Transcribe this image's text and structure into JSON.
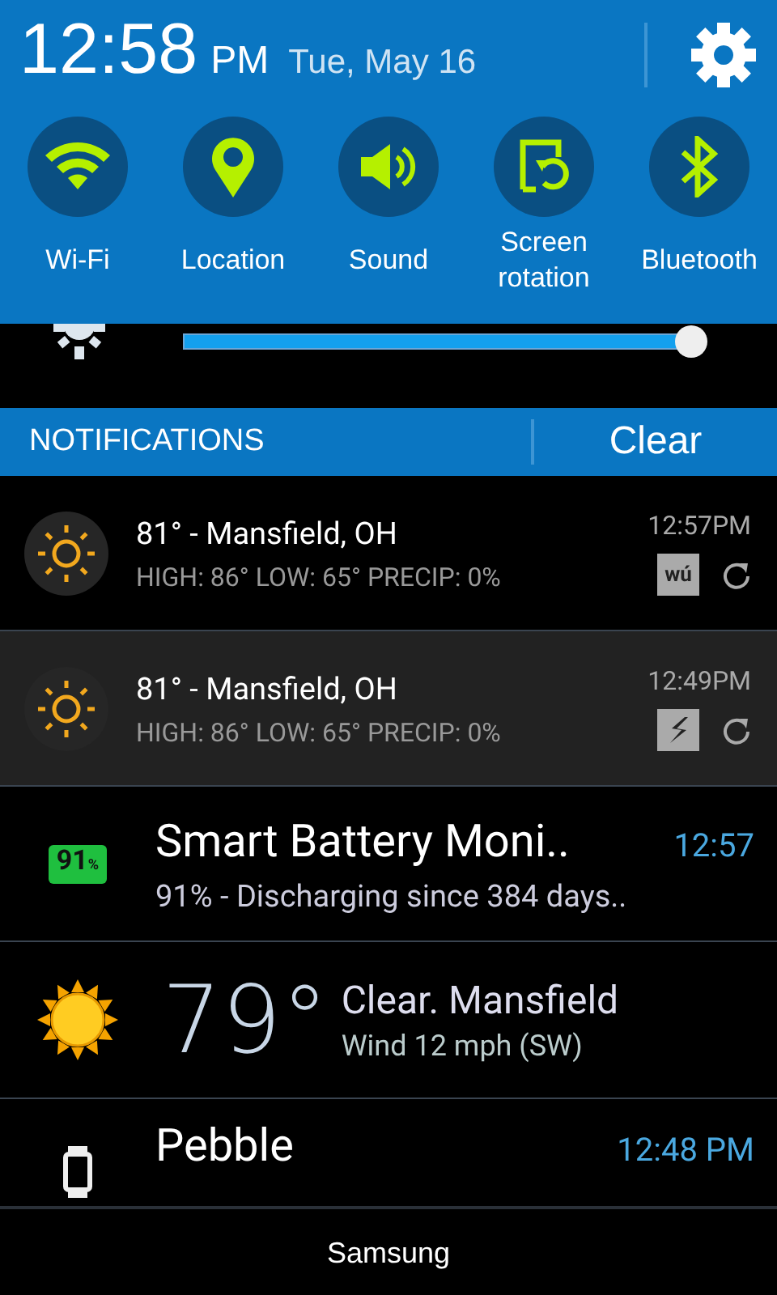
{
  "header": {
    "time": "12:58",
    "ampm": "PM",
    "date": "Tue, May 16"
  },
  "toggles": [
    {
      "kind": "wifi",
      "label": "Wi-Fi",
      "on": true
    },
    {
      "kind": "location",
      "label": "Location",
      "on": true
    },
    {
      "kind": "sound",
      "label": "Sound",
      "on": true
    },
    {
      "kind": "rotation",
      "label": "Screen rotation",
      "on": true
    },
    {
      "kind": "bluetooth",
      "label": "Bluetooth",
      "on": true
    }
  ],
  "brightness": {
    "level": 0.98
  },
  "notifications_bar": {
    "title": "NOTIFICATIONS",
    "clear": "Clear"
  },
  "notifications": [
    {
      "kind": "weather_ticker",
      "title": "81° - Mansfield, OH",
      "text": "HIGH: 86° LOW: 65° PRECIP: 0%",
      "time": "12:57PM",
      "badge": {
        "kind": "text",
        "text": "wú"
      },
      "selected": false
    },
    {
      "kind": "weather_ticker",
      "title": "81° - Mansfield, OH",
      "text": "HIGH: 86° LOW: 65° PRECIP: 0%",
      "time": "12:49PM",
      "badge": {
        "kind": "bolt"
      },
      "selected": true
    },
    {
      "kind": "battery",
      "icon_text": "91",
      "icon_unit": "%",
      "title": "Smart Battery Moni..",
      "text": "91% - Discharging since 384 days..",
      "time": "12:57"
    },
    {
      "kind": "weather_big",
      "temp": "79°",
      "title": "Clear. Mansfield",
      "text": "Wind 12 mph (SW)"
    },
    {
      "kind": "pebble",
      "title": "Pebble",
      "time": "12:48 PM"
    }
  ],
  "carrier": "Samsung"
}
